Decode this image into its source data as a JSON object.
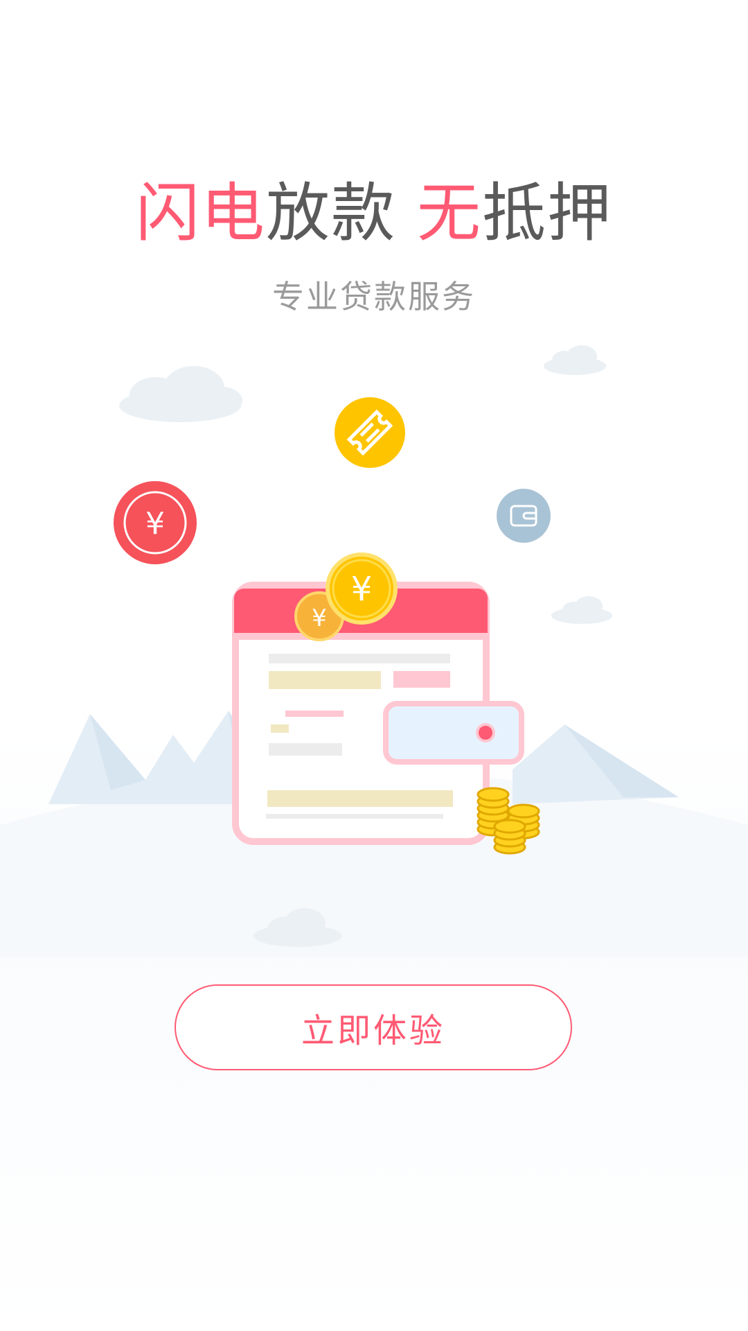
{
  "headline": {
    "part1_accent": "闪电",
    "part2": "放款",
    "part3_accent": "无",
    "part4": "抵押"
  },
  "subtitle": "专业贷款服务",
  "illustration": {
    "coin_symbol": "¥",
    "icons": [
      "coupon-icon",
      "yuan-icon",
      "wallet-icon",
      "yuan-coin-icon",
      "coin-stack-icon"
    ]
  },
  "cta": {
    "label": "立即体验"
  },
  "colors": {
    "accent": "#ff5a73",
    "text": "#5a5a5a",
    "subtext": "#9a9a9a",
    "gold": "#ffc400",
    "red_coin": "#f5525a",
    "wallet_blue": "#a9c3d6"
  }
}
